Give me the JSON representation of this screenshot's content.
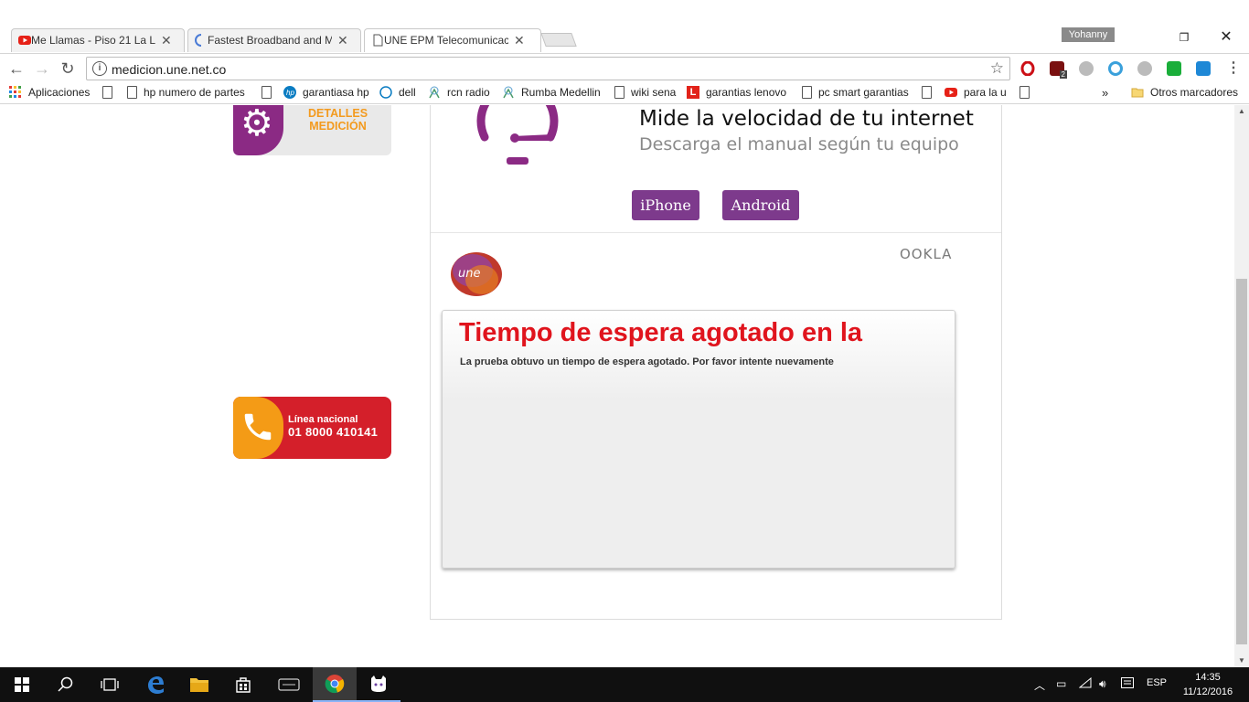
{
  "tabs": [
    {
      "title": "Me Llamas - Piso 21 La L",
      "icon": "youtube-icon"
    },
    {
      "title": "Fastest Broadband and M",
      "icon": "loading-icon"
    },
    {
      "title": "UNE EPM Telecomunicac",
      "icon": "page-icon"
    }
  ],
  "window": {
    "user": "Yohanny"
  },
  "omnibox": {
    "url": "medicion.une.net.co"
  },
  "bookmarks": [
    {
      "label": "Aplicaciones",
      "icon": "apps-grid-icon"
    },
    {
      "label": "hp numero de partes",
      "icon": "page-icon"
    },
    {
      "label": "garantiasa hp",
      "icon": "hp-icon"
    },
    {
      "label": "dell",
      "icon": "dell-icon"
    },
    {
      "label": "rcn radio",
      "icon": "radio-icon"
    },
    {
      "label": "Rumba Medellin",
      "icon": "radio-icon"
    },
    {
      "label": "wiki sena",
      "icon": "page-icon"
    },
    {
      "label": "garantias lenovo",
      "icon": "lenovo-icon"
    },
    {
      "label": "pc smart garantias",
      "icon": "page-icon"
    },
    {
      "label": "para la u",
      "icon": "youtube-icon"
    },
    {
      "label": "Otros marcadores",
      "icon": "folder-icon"
    }
  ],
  "sidebar": {
    "detalles_line1": "DETALLES",
    "detalles_line2": "MEDICIÓN",
    "linea_label": "Línea nacional",
    "linea_number": "01 8000 410141"
  },
  "panel": {
    "headline": "Mide la velocidad de tu internet",
    "subline": "Descarga el manual según tu equipo",
    "iphone_label": "iPhone",
    "android_label": "Android",
    "ookla": "OOKLA",
    "une_logo_text": "une"
  },
  "error": {
    "title": "Tiempo de espera agotado en la",
    "message": "La prueba obtuvo un tiempo de espera agotado. Por favor intente nuevamente"
  },
  "taskbar": {
    "lang": "ESP",
    "time": "14:35",
    "date": "11/12/2016"
  },
  "colors": {
    "une_purple": "#7d3a8c",
    "error_red": "#e0141d",
    "hotline_red": "#d41f2a",
    "hotline_orange": "#f49b16",
    "detalles_orange": "#f39a1e"
  }
}
